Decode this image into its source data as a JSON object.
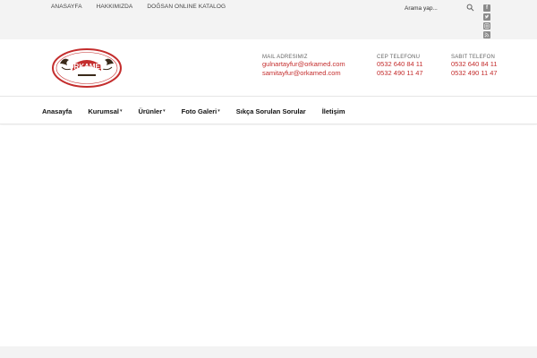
{
  "topbar": {
    "links": [
      "ANASAYFA",
      "HAKKIMIZDA",
      "DOĞSAN ONLINE KATALOG"
    ],
    "search_placeholder": "Arama yap...",
    "search_icon": "search-icon",
    "social_icons": [
      "facebook-icon",
      "twitter-icon",
      "instagram-icon",
      "rss-icon"
    ]
  },
  "header": {
    "logo_text": "ORKAMED",
    "mail": {
      "label": "MAIL ADRESIMIZ",
      "values": [
        "gulnartayfur@orkamed.com",
        "samitayfur@orkamed.com"
      ]
    },
    "cep": {
      "label": "CEP TELEFONU",
      "values": [
        "0532 640 84 11",
        "0532 490 11 47"
      ]
    },
    "sabit": {
      "label": "SABIT TELEFON",
      "values": [
        "0532 640 84 11",
        "0532 490 11 47"
      ]
    }
  },
  "nav": {
    "items": [
      {
        "label": "Anasayfa",
        "dropdown": false
      },
      {
        "label": "Kurumsal",
        "dropdown": true
      },
      {
        "label": "Ürünler",
        "dropdown": true
      },
      {
        "label": "Foto Galeri",
        "dropdown": true
      },
      {
        "label": "Sıkça Sorulan Sorular",
        "dropdown": false
      },
      {
        "label": "İletişim",
        "dropdown": false
      }
    ]
  },
  "colors": {
    "accent": "#c42d2d",
    "topbar_bg": "#f3f3f3"
  }
}
